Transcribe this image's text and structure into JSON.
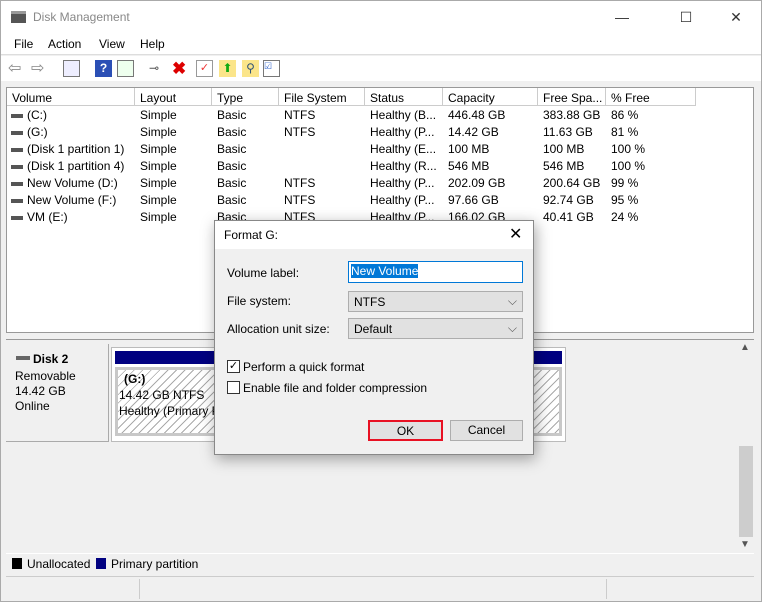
{
  "window": {
    "title": "Disk Management",
    "controls": [
      "—",
      "☐",
      "✕"
    ]
  },
  "menu": [
    "File",
    "Action",
    "View",
    "Help"
  ],
  "toolbar": [
    "back-icon",
    "forward-icon",
    "console-tree-icon",
    "help-icon",
    "action-pane-icon",
    "connect-disk-icon",
    "delete-icon",
    "properties-icon",
    "folder-up-icon",
    "folder-search-icon",
    "checklist-icon"
  ],
  "table": {
    "columns": [
      "Volume",
      "Layout",
      "Type",
      "File System",
      "Status",
      "Capacity",
      "Free Spa...",
      "% Free"
    ],
    "rows": [
      [
        "(C:)",
        "Simple",
        "Basic",
        "NTFS",
        "Healthy (B...",
        "446.48 GB",
        "383.88 GB",
        "86 %"
      ],
      [
        "(G:)",
        "Simple",
        "Basic",
        "NTFS",
        "Healthy (P...",
        "14.42 GB",
        "11.63 GB",
        "81 %"
      ],
      [
        "(Disk 1 partition 1)",
        "Simple",
        "Basic",
        "",
        "Healthy (E...",
        "100 MB",
        "100 MB",
        "100 %"
      ],
      [
        "(Disk 1 partition 4)",
        "Simple",
        "Basic",
        "",
        "Healthy (R...",
        "546 MB",
        "546 MB",
        "100 %"
      ],
      [
        "New Volume (D:)",
        "Simple",
        "Basic",
        "NTFS",
        "Healthy (P...",
        "202.09 GB",
        "200.64 GB",
        "99 %"
      ],
      [
        "New Volume (F:)",
        "Simple",
        "Basic",
        "NTFS",
        "Healthy (P...",
        "97.66 GB",
        "92.74 GB",
        "95 %"
      ],
      [
        "VM (E:)",
        "Simple",
        "Basic",
        "NTFS",
        "Healthy (P...",
        "166.02 GB",
        "40.41 GB",
        "24 %"
      ]
    ]
  },
  "disk": {
    "name": "Disk 2",
    "type": "Removable",
    "size": "14.42 GB",
    "state": "Online",
    "partition": {
      "name": "(G:)",
      "size": "14.42 GB NTFS",
      "status": "Healthy (Primary P"
    }
  },
  "legend": [
    {
      "label": "Unallocated",
      "color": "#000000"
    },
    {
      "label": "Primary partition",
      "color": "#000080"
    }
  ],
  "dialog": {
    "title": "Format G:",
    "volume_label_caption": "Volume label:",
    "volume_label_value": "New Volume",
    "file_system_caption": "File system:",
    "file_system_value": "NTFS",
    "alloc_caption": "Allocation unit size:",
    "alloc_value": "Default",
    "quick_format": "Perform a quick format",
    "quick_format_checked": true,
    "compression": "Enable file and folder compression",
    "compression_checked": false,
    "ok": "OK",
    "cancel": "Cancel",
    "highlight_color": "#e81123"
  }
}
